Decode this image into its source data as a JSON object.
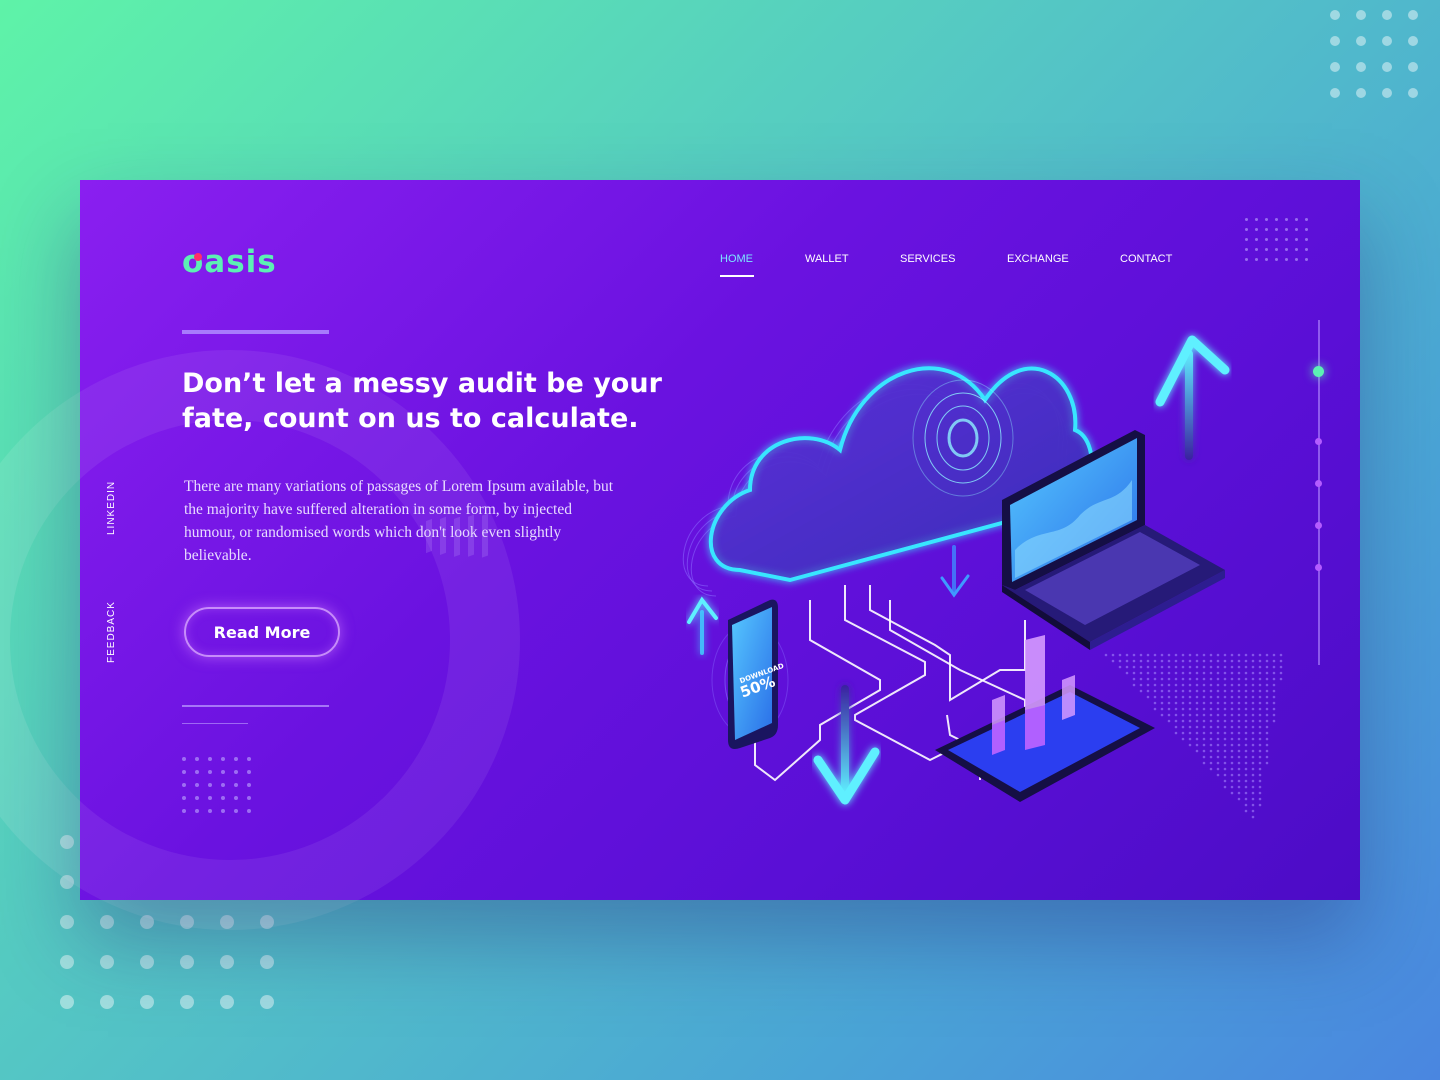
{
  "brand": {
    "logo": "oasis",
    "colors": {
      "accent": "#5cf0b4",
      "primary": "#6a12e0",
      "nav_active": "#7ce6ff"
    }
  },
  "nav": {
    "items": [
      {
        "label": "HOME",
        "active": true
      },
      {
        "label": "WALLET",
        "active": false
      },
      {
        "label": "SERVICES",
        "active": false
      },
      {
        "label": "EXCHANGE",
        "active": false
      },
      {
        "label": "CONTACT",
        "active": false
      }
    ]
  },
  "hero": {
    "headline": "Don’t let a messy audit be your fate, count on us to calculate.",
    "paragraph": "There are many variations of passages of Lorem Ipsum available, but the majority have suffered alteration in some form, by injected humour, or randomised words which don't look even slightly believable.",
    "cta_label": "Read More"
  },
  "social": {
    "linkedin": "LINKEDIN",
    "feedback": "FEEDBACK"
  },
  "illustration": {
    "phone_line1": "DOWNLOAD",
    "phone_line2": "50%"
  }
}
